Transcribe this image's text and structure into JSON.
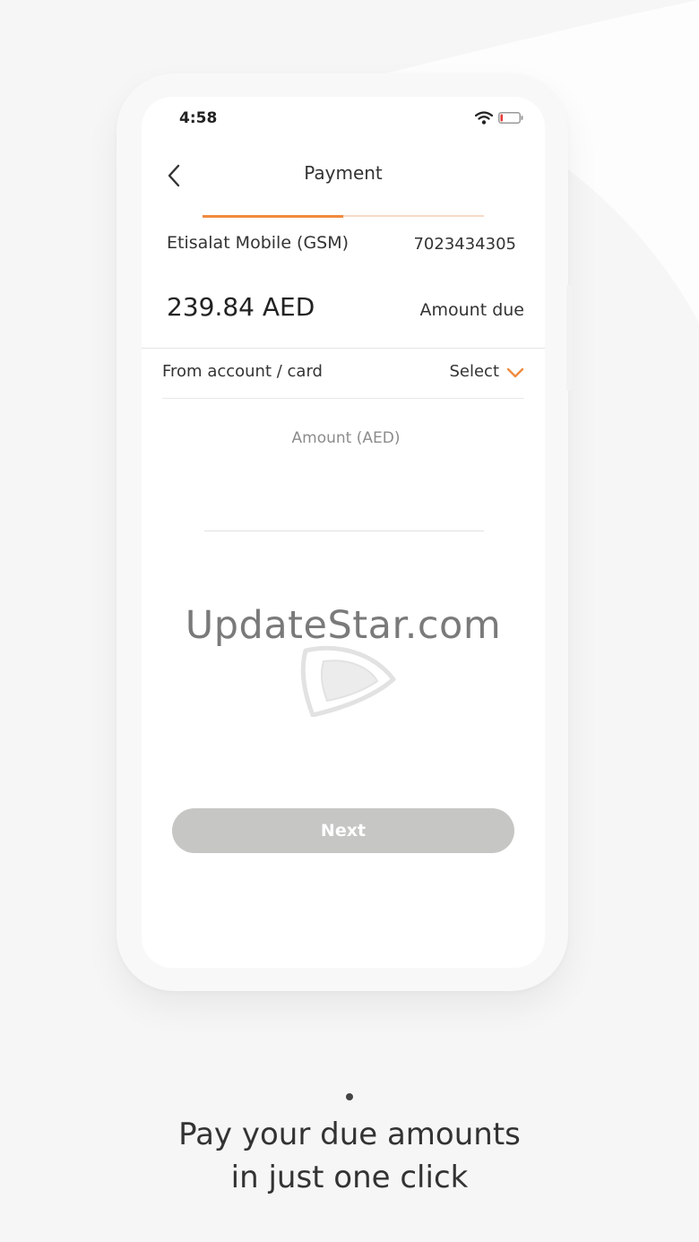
{
  "status_bar": {
    "time": "4:58"
  },
  "header": {
    "title": "Payment",
    "progress_fraction": 0.5
  },
  "bill": {
    "service_name": "Etisalat Mobile (GSM)",
    "service_number": "7023434305",
    "amount": "239.84 AED",
    "amount_label": "Amount due"
  },
  "payment_source": {
    "label": "From account / card",
    "select_label": "Select"
  },
  "amount_input": {
    "placeholder": "Amount (AED)",
    "value": ""
  },
  "actions": {
    "next_label": "Next"
  },
  "watermark": {
    "text": "UpdateStar.com"
  },
  "caption": {
    "line1": "Pay your due amounts",
    "line2": "in just one click"
  },
  "colors": {
    "accent": "#f08a3e",
    "accent_light": "#f6d9c6",
    "button_disabled": "#c6c7c4",
    "background": "#f6f6f6",
    "screen": "#ffffff"
  },
  "icons": {
    "back": "chevron-left-icon",
    "dropdown": "chevron-down-icon",
    "wifi": "wifi-icon",
    "battery": "battery-icon"
  }
}
